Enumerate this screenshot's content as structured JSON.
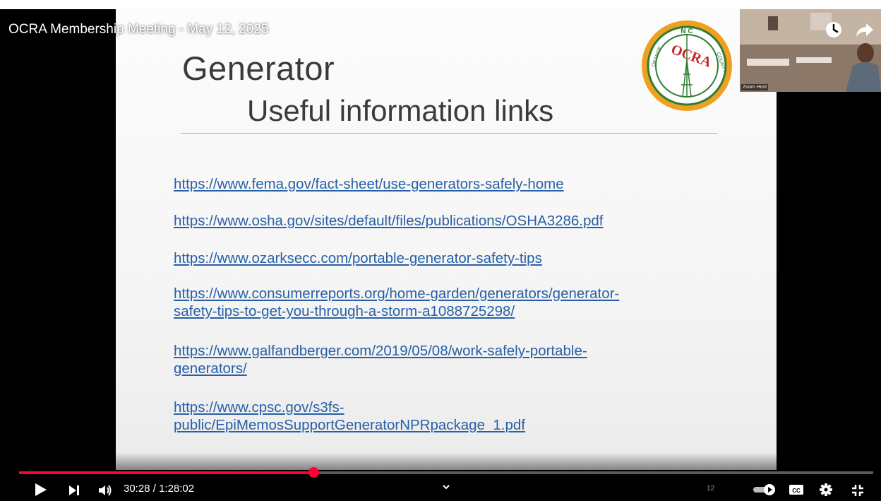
{
  "video": {
    "title": "OCRA Membership Meeting - May 12, 2025",
    "current_time": "30:28",
    "duration": "1:28:02",
    "time_separator": " / ",
    "progress_fraction": 0.345
  },
  "slide": {
    "title": "Generator",
    "subtitle": "Useful information links",
    "links": [
      [
        "https://www.fema.gov/fact-sheet/use-generators-safely-home"
      ],
      [
        "https://www.osha.gov/sites/default/files/publications/OSHA3286.pdf"
      ],
      [
        "https://www.ozarksecc.com/portable-generator-safety-tips"
      ],
      [
        "https://www.consumerreports.org/home-garden/generators/generator-",
        "safety-tips-to-get-you-through-a-storm-a1088725298/"
      ],
      [
        "https://www.galfandberger.com/2019/05/08/work-safely-portable-",
        "generators/"
      ],
      [
        "https://www.cpsc.gov/s3fs-",
        "public/EpiMemosSupportGeneratorNPRpackage_1.pdf"
      ]
    ],
    "logo": {
      "top_text": "N C",
      "center_text": "OCRA",
      "left_text": "ORANGE",
      "right_text": "COUNTY"
    }
  },
  "webcam": {
    "label": "Zoom Host"
  },
  "controls": {
    "subtitle_track_number": "12",
    "icons": {
      "play": "play-icon",
      "next": "next-icon",
      "volume": "volume-icon",
      "chapter": "chevron-down-icon",
      "autoplay": "autoplay-toggle-icon",
      "captions": "captions-icon",
      "settings": "gear-icon",
      "exit_fullscreen": "exit-fullscreen-icon",
      "watch_later": "clock-icon",
      "share": "share-icon"
    }
  },
  "colors": {
    "progress": "#ff0033",
    "link": "#2860a8",
    "slide_text": "#3a3a3a",
    "logo_orange": "#f0a020",
    "logo_green": "#2e7d32"
  }
}
